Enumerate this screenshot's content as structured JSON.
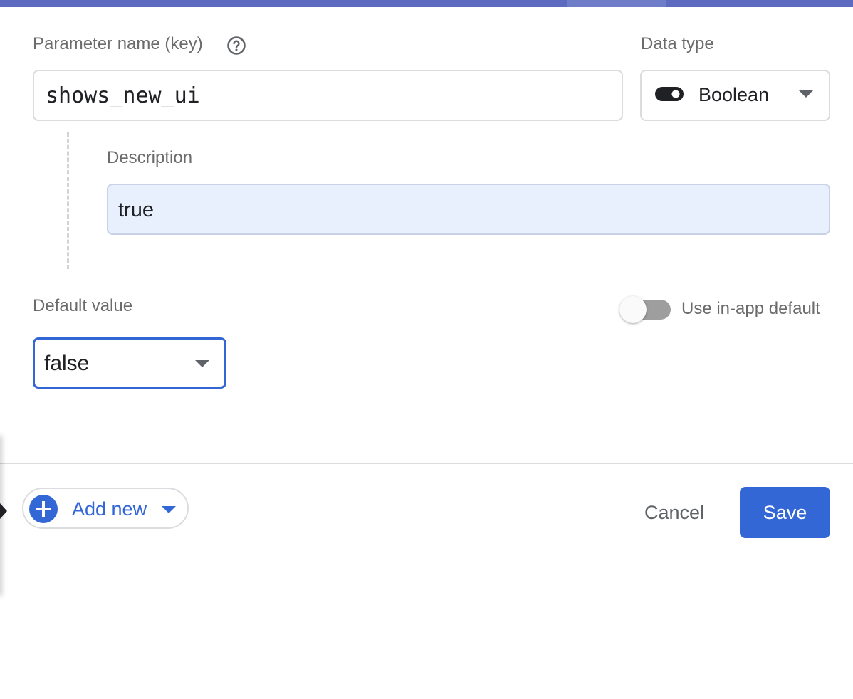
{
  "form": {
    "param_name": {
      "label": "Parameter name (key)",
      "value": "shows_new_ui",
      "help_icon": "help-circle-icon"
    },
    "data_type": {
      "label": "Data type",
      "value": "Boolean",
      "icon": "toggle-icon"
    },
    "description": {
      "label": "Description",
      "value": "true"
    },
    "default_value": {
      "label": "Default value",
      "value": "false"
    },
    "use_in_app_default": {
      "label": "Use in-app default",
      "enabled": false
    }
  },
  "footer": {
    "add_new_label": "Add new",
    "cancel_label": "Cancel",
    "save_label": "Save"
  },
  "colors": {
    "accent": "#3367d6",
    "header_strip": "#5c6bc0",
    "description_bg": "#e8f0fe"
  }
}
